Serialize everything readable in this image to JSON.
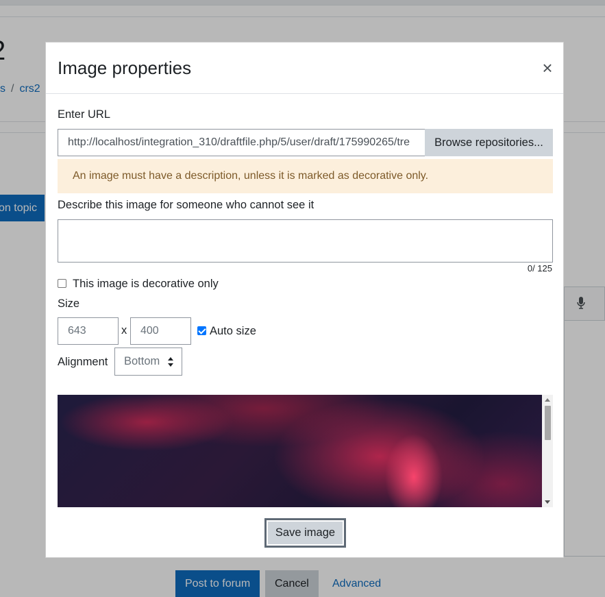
{
  "background": {
    "heading": "2",
    "breadcrumb": [
      "s",
      "crs2"
    ],
    "breadcrumb_sep": "/",
    "topic_button": "on topic",
    "buttons": {
      "post": "Post to forum",
      "cancel": "Cancel",
      "advanced": "Advanced"
    }
  },
  "modal": {
    "title": "Image properties",
    "close_glyph": "×",
    "url": {
      "label": "Enter URL",
      "value": "http://localhost/integration_310/draftfile.php/5/user/draft/175990265/tre",
      "browse_label": "Browse repositories..."
    },
    "warning": "An image must have a description, unless it is marked as decorative only.",
    "description": {
      "label": "Describe this image for someone who cannot see it",
      "value": "",
      "counter": "0/ 125"
    },
    "decorative": {
      "label": "This image is decorative only",
      "checked": false
    },
    "size": {
      "label": "Size",
      "width": "643",
      "separator": "x",
      "height": "400",
      "auto_label": "Auto size",
      "auto_checked": true
    },
    "alignment": {
      "label": "Alignment",
      "selected": "Bottom"
    },
    "save_label": "Save image"
  },
  "colors": {
    "primary": "#0f6cbf",
    "warning_bg": "#fcefdc",
    "warning_text": "#7d5a29",
    "secondary_btn": "#ced4da",
    "checkbox_checked": "#0075ff"
  },
  "icons": {
    "close": "close-icon",
    "mic": "microphone-icon",
    "select_arrows": "sort-arrows-icon",
    "scroll_up": "scroll-up-arrow-icon",
    "scroll_down": "scroll-down-arrow-icon"
  }
}
